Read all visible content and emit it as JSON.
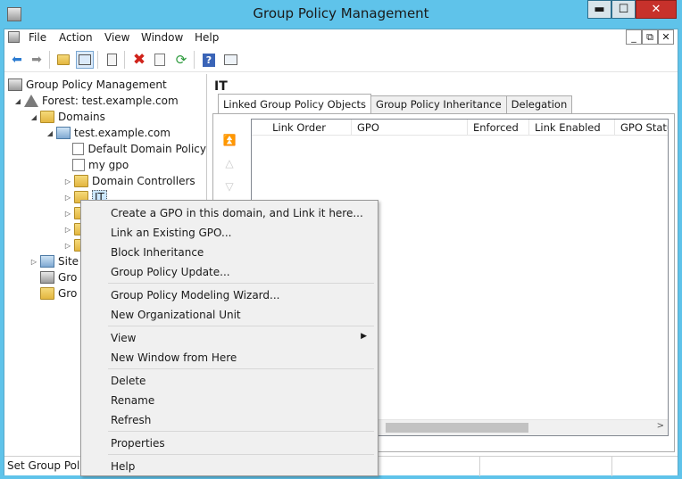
{
  "window": {
    "title": "Group Policy Management",
    "min_label": "▬",
    "max_label": "☐",
    "close_label": "✕"
  },
  "menubar": {
    "items": [
      "File",
      "Action",
      "View",
      "Window",
      "Help"
    ]
  },
  "mdi": {
    "min": "_",
    "restore": "⧉",
    "close": "✕"
  },
  "toolbar": {
    "icons": [
      "back-icon",
      "forward-icon",
      "up-folder-icon",
      "show-hide-tree-icon",
      "clipboard-icon",
      "delete-icon",
      "properties-icon",
      "refresh-icon",
      "help-icon",
      "console-icon"
    ]
  },
  "tree": {
    "root": "Group Policy Management",
    "forest": "Forest: test.example.com",
    "domains": "Domains",
    "domain": "test.example.com",
    "items": [
      "Default Domain Policy",
      "my gpo",
      "Domain Controllers",
      "IT"
    ],
    "sites": "Site",
    "gpo_objects": "Gro",
    "starter": "Gro"
  },
  "right": {
    "title": "IT",
    "tabs": [
      "Linked Group Policy Objects",
      "Group Policy Inheritance",
      "Delegation"
    ],
    "columns": [
      "Link Order",
      "GPO",
      "Enforced",
      "Link Enabled",
      "GPO Statu"
    ]
  },
  "context_menu": {
    "items": [
      "Create a GPO in this domain, and Link it here...",
      "Link an Existing GPO...",
      "Block Inheritance",
      "Group Policy Update...",
      "Group Policy Modeling Wizard...",
      "New Organizational Unit",
      "View",
      "New Window from Here",
      "Delete",
      "Rename",
      "Refresh",
      "Properties",
      "Help"
    ]
  },
  "status": {
    "text": "Set Group Policy"
  },
  "colors": {
    "titlebar": "#5fc3ea",
    "close": "#c7312b",
    "selection": "#cce8ff"
  }
}
